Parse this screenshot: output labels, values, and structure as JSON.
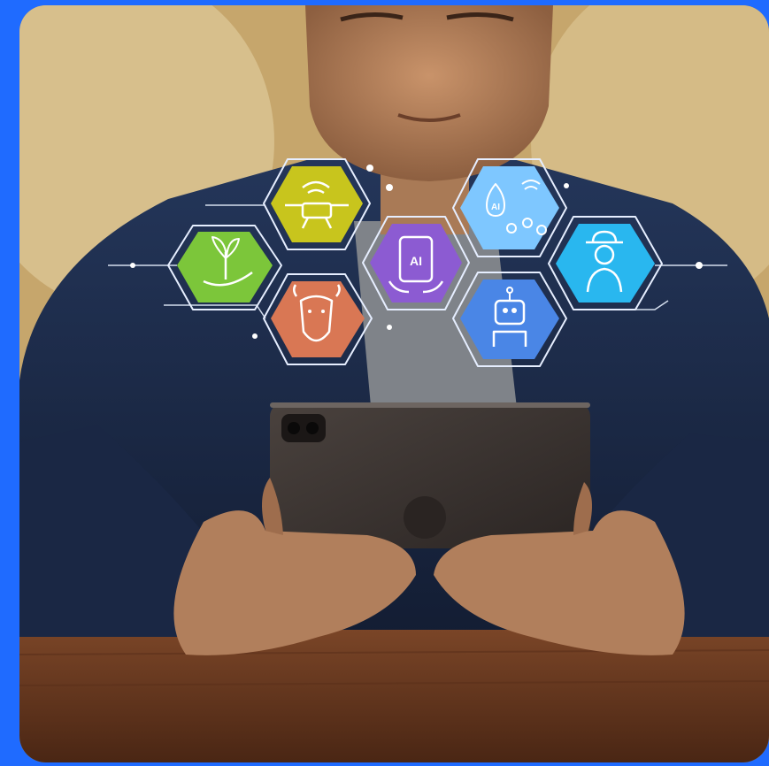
{
  "scene": {
    "description_label": "",
    "colors": {
      "outer_background": "#1f6bff",
      "wall": "#cdb07a",
      "jacket": "#1c2a45",
      "shirt": "#8c8f94",
      "skin": "#b88661",
      "tablet": "#3a3431",
      "table": "#6b3b22",
      "hex_plant": "#7cc63a",
      "hex_drone": "#c8c51d",
      "hex_ai_phone": "#8c5bd2",
      "hex_ai_water": "#7ec7ff",
      "hex_farmer": "#29b7ef",
      "hex_cow": "#d97754",
      "hex_robot": "#4a86e6"
    },
    "hex_icons": [
      {
        "name": "plant-hand-icon",
        "color_key": "hex_plant"
      },
      {
        "name": "drone-wifi-icon",
        "color_key": "hex_drone"
      },
      {
        "name": "ai-smartphone-icon",
        "color_key": "hex_ai_phone",
        "text": "AI"
      },
      {
        "name": "ai-water-drops-icon",
        "color_key": "hex_ai_water",
        "text": "AI"
      },
      {
        "name": "farmer-icon",
        "color_key": "hex_farmer"
      },
      {
        "name": "cow-icon",
        "color_key": "hex_cow"
      },
      {
        "name": "robot-icon",
        "color_key": "hex_robot"
      }
    ]
  }
}
